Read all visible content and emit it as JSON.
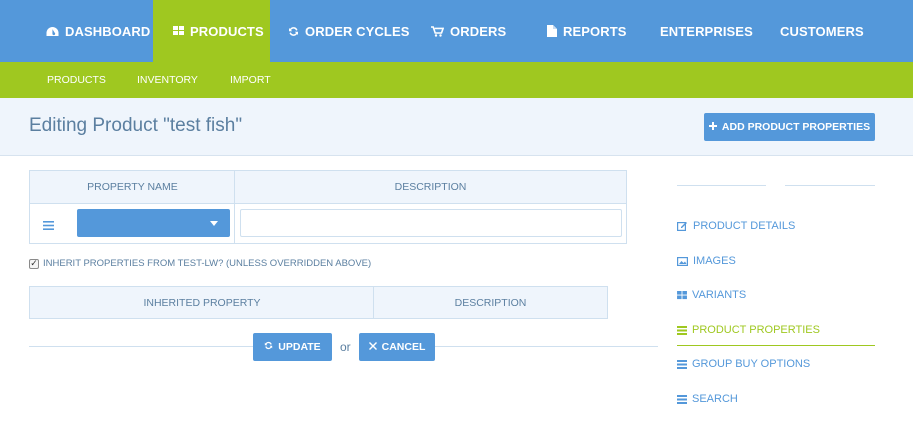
{
  "topnav": {
    "items": [
      {
        "label": "DASHBOARD",
        "icon": "dashboard-icon"
      },
      {
        "label": "PRODUCTS",
        "icon": "grid-icon",
        "active": true
      },
      {
        "label": "ORDER CYCLES",
        "icon": "refresh-icon"
      },
      {
        "label": "ORDERS",
        "icon": "cart-icon"
      },
      {
        "label": "REPORTS",
        "icon": "document-icon"
      },
      {
        "label": "ENTERPRISES"
      },
      {
        "label": "CUSTOMERS"
      }
    ]
  },
  "subnav": {
    "items": [
      {
        "label": "PRODUCTS",
        "active": true
      },
      {
        "label": "INVENTORY"
      },
      {
        "label": "IMPORT"
      }
    ]
  },
  "page": {
    "title": "Editing Product \"test fish\"",
    "add_button": "ADD PRODUCT PROPERTIES"
  },
  "properties_table": {
    "headers": [
      "PROPERTY NAME",
      "DESCRIPTION"
    ],
    "row": {
      "property_name": "",
      "description": ""
    }
  },
  "inherit": {
    "checked": true,
    "label": "INHERIT PROPERTIES FROM TEST-LW? (UNLESS OVERRIDDEN ABOVE)"
  },
  "inherited_table": {
    "headers": [
      "INHERITED PROPERTY",
      "DESCRIPTION"
    ]
  },
  "actions": {
    "update": "UPDATE",
    "or": "or",
    "cancel": "CANCEL"
  },
  "sidebar": {
    "items": [
      {
        "label": "PRODUCT DETAILS",
        "icon": "edit-icon"
      },
      {
        "label": "IMAGES",
        "icon": "image-icon"
      },
      {
        "label": "VARIANTS",
        "icon": "grid-icon"
      },
      {
        "label": "PRODUCT PROPERTIES",
        "icon": "list-icon",
        "active": true
      },
      {
        "label": "GROUP BUY OPTIONS",
        "icon": "list-icon"
      },
      {
        "label": "SEARCH",
        "icon": "list-icon"
      }
    ]
  },
  "colors": {
    "primary_blue": "#5498da",
    "green": "#9fc820",
    "header_bg": "#eff5fc",
    "text": "#5b7fa0"
  }
}
